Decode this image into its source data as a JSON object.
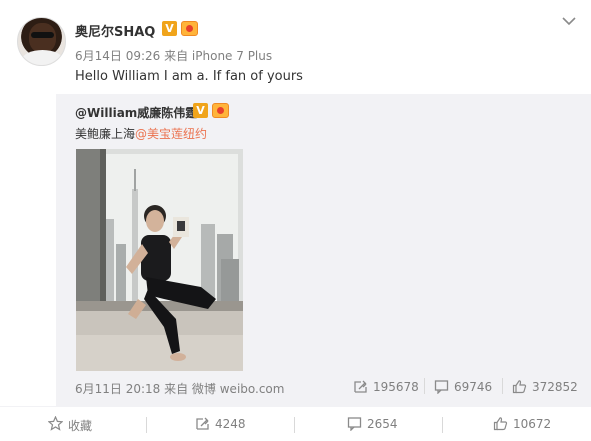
{
  "post": {
    "author": "奥尼尔SHAQ",
    "verified_badge": "V",
    "meta": "6月14日 09:26 来自 iPhone 7 Plus",
    "text": "Hello William I am a. If fan of yours"
  },
  "repost": {
    "author": "@William威廉陈伟霆",
    "verified_badge": "V",
    "text_prefix": "美鲍廉上海",
    "mention": "@美宝莲纽约",
    "meta": "6月11日 20:18 来自 微博 weibo.com",
    "stats": {
      "reposts": "195678",
      "comments": "69746",
      "likes": "372852"
    }
  },
  "actions": {
    "favorite": "收藏",
    "repost": "4248",
    "comment": "2654",
    "like": "10672"
  },
  "colors": {
    "mention": "#eb7350",
    "badge": "#f0a41b",
    "repost_bg": "#f2f2f5",
    "meta": "#808080"
  },
  "icons": [
    "chevron-down-icon",
    "verified-icon",
    "medal-icon",
    "repost-icon",
    "comment-icon",
    "like-icon",
    "favorite-icon"
  ]
}
